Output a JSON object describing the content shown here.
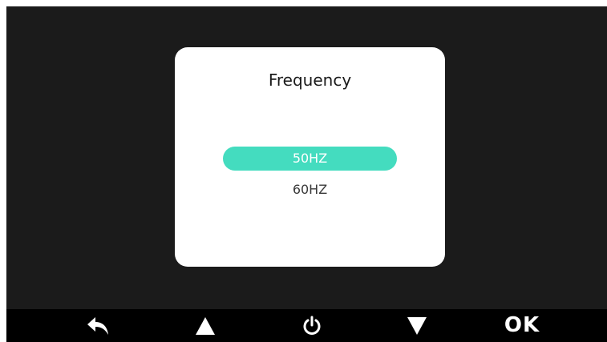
{
  "dialog": {
    "title": "Frequency",
    "options": [
      {
        "label": "50HZ",
        "selected": true
      },
      {
        "label": "60HZ",
        "selected": false
      }
    ],
    "accent_color": "#44dcbf"
  },
  "bottom_bar": {
    "buttons": [
      {
        "icon": "back-arrow-icon"
      },
      {
        "icon": "triangle-up-icon"
      },
      {
        "icon": "power-icon"
      },
      {
        "icon": "triangle-down-icon"
      },
      {
        "label": "OK"
      }
    ]
  }
}
